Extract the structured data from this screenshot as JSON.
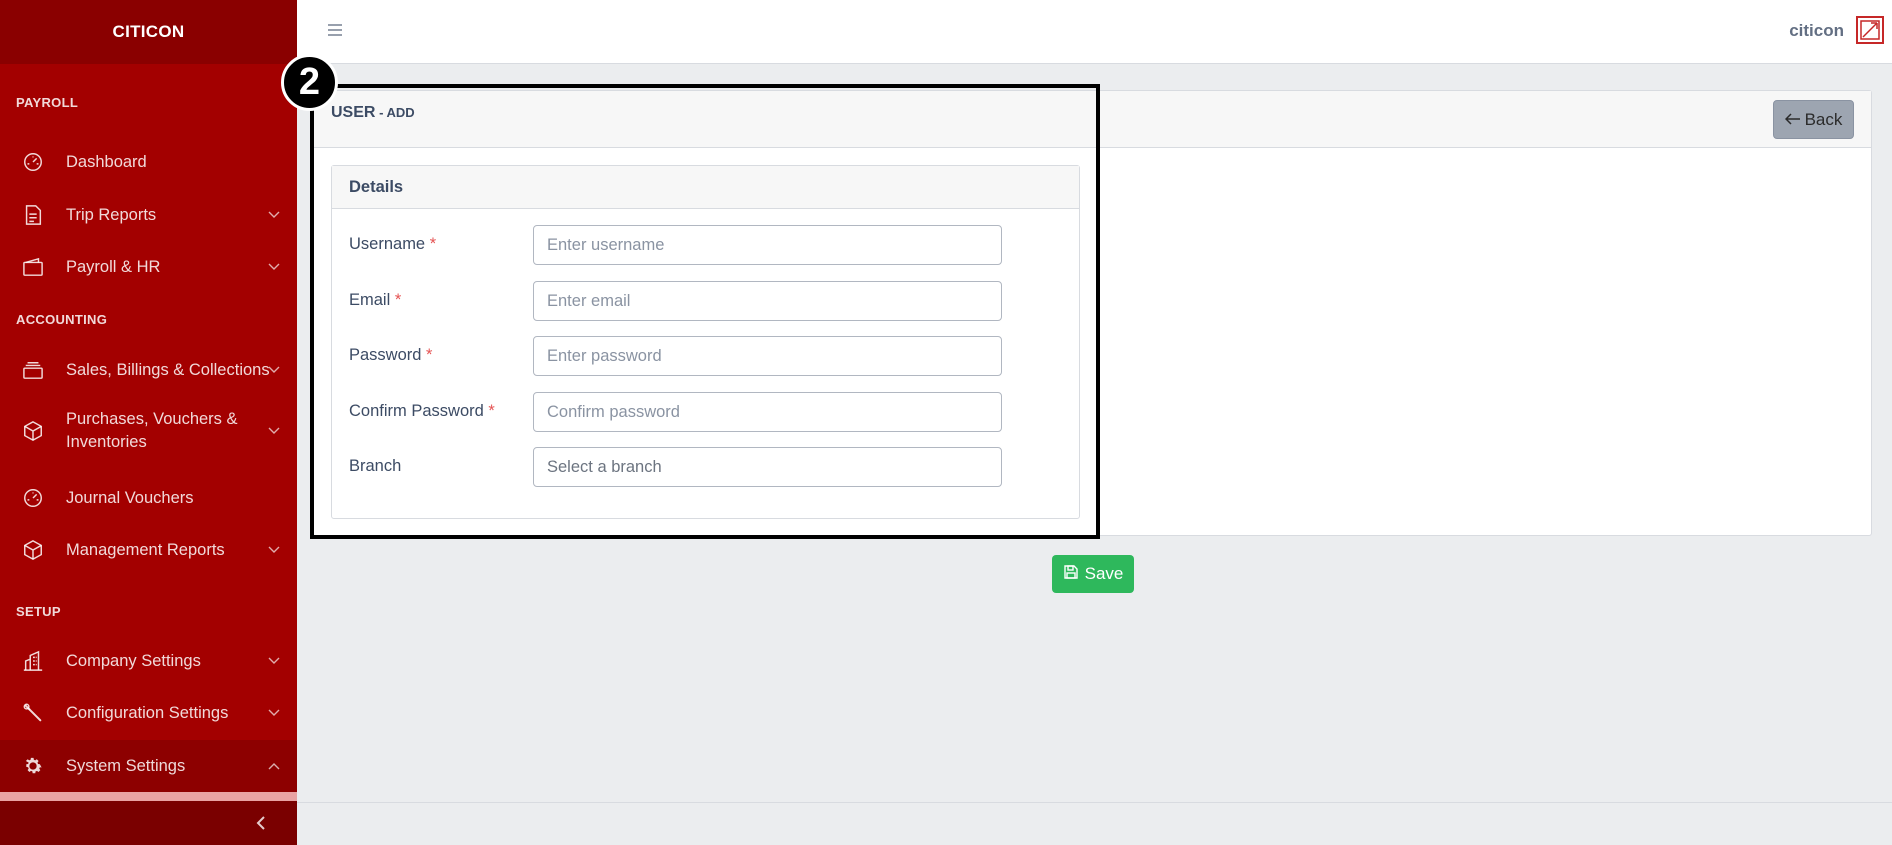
{
  "app": {
    "brand": "CITICON"
  },
  "sidebar": {
    "sections": [
      {
        "title": "PAYROLL"
      },
      {
        "title": "ACCOUNTING"
      },
      {
        "title": "SETUP"
      }
    ],
    "items": [
      {
        "label": "Dashboard",
        "icon": "speedometer-icon"
      },
      {
        "label": "Trip Reports",
        "icon": "document-icon"
      },
      {
        "label": "Payroll & HR",
        "icon": "wallet-icon"
      },
      {
        "label": "Sales, Billings & Collections",
        "icon": "layers-icon"
      },
      {
        "label": "Purchases, Vouchers & Inventories",
        "icon": "box-icon"
      },
      {
        "label": "Journal Vouchers",
        "icon": "speedometer-icon"
      },
      {
        "label": "Management Reports",
        "icon": "box-icon"
      },
      {
        "label": "Company Settings",
        "icon": "building-icon"
      },
      {
        "label": "Configuration Settings",
        "icon": "wrench-icon"
      },
      {
        "label": "System Settings",
        "icon": "gear-icon",
        "active": true
      }
    ]
  },
  "header": {
    "user_name": "citicon"
  },
  "page": {
    "title": "USER",
    "subtitle": " - ADD",
    "back_label": "Back",
    "details_title": "Details",
    "save_label": "Save",
    "annotation_number": "2"
  },
  "form": {
    "fields": [
      {
        "label": "Username",
        "required": "*",
        "placeholder": "Enter username"
      },
      {
        "label": "Email",
        "required": "*",
        "placeholder": "Enter email"
      },
      {
        "label": "Password",
        "required": "*",
        "placeholder": "Enter password"
      },
      {
        "label": "Confirm Password",
        "required": "*",
        "placeholder": "Confirm password"
      },
      {
        "label": "Branch",
        "required": "",
        "placeholder": "Select a branch"
      }
    ]
  },
  "colors": {
    "sidebar": "#a30000",
    "brand_bar": "#8a0000",
    "save": "#2eb85c",
    "back": "#9da5b1",
    "required": "#e55353"
  }
}
